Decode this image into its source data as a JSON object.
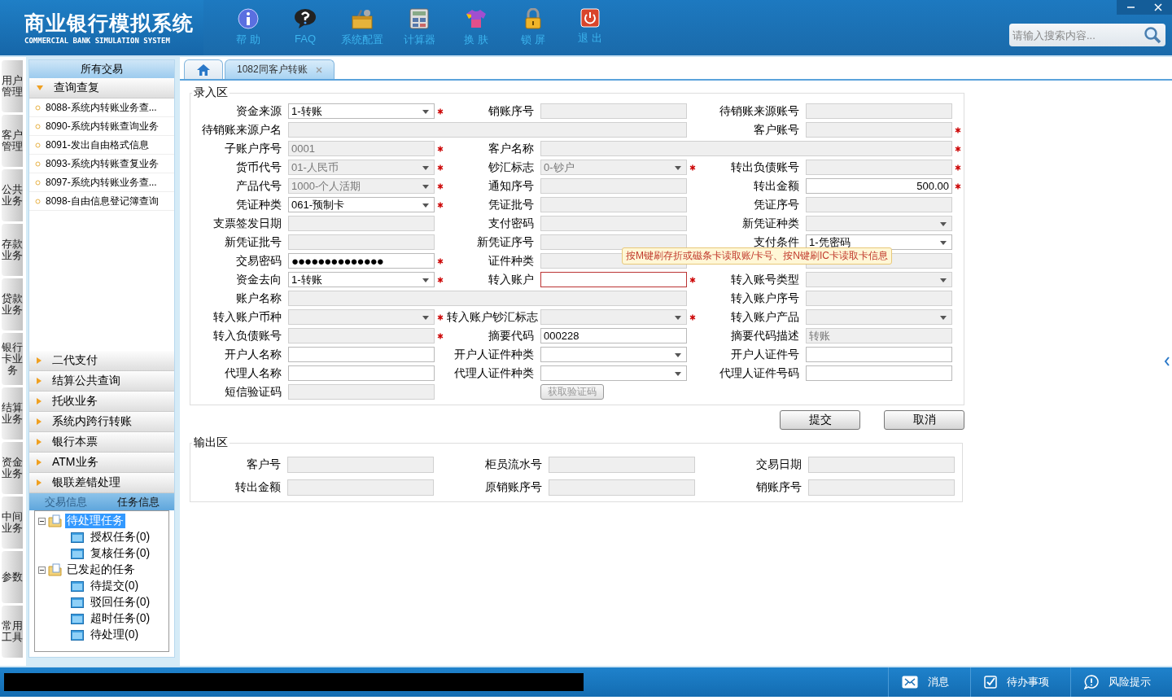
{
  "header": {
    "title": "商业银行模拟系统",
    "subtitle": "COMMERCIAL BANK SIMULATION SYSTEM",
    "nav": [
      {
        "kind": "info",
        "label": "帮 助"
      },
      {
        "kind": "faq",
        "label": "FAQ"
      },
      {
        "kind": "config",
        "label": "系统配置"
      },
      {
        "kind": "calc",
        "label": "计算器"
      },
      {
        "kind": "skin",
        "label": "换 肤"
      },
      {
        "kind": "lock",
        "label": "锁 屏"
      },
      {
        "kind": "exit",
        "label": "退 出"
      }
    ],
    "search": {
      "placeholder": "请输入搜索内容..."
    }
  },
  "tabs": [
    {
      "kind": "home",
      "selected": false
    },
    {
      "kind": "page",
      "label": "1082同客户转账",
      "selected": true
    }
  ],
  "side_tabs": [
    "用户管理",
    "客户管理",
    "公共业务",
    "存款业务",
    "贷款业务",
    "银行卡业务",
    "结算业务",
    "资金业务",
    "中间业务",
    "参数",
    "常用工具"
  ],
  "sidebar": {
    "title": "所有交易",
    "sections": [
      {
        "label": "查询查复",
        "expanded": true,
        "items": [
          "8088-系统内转账业务查...",
          "8090-系统内转账查询业务",
          "8091-发出自由格式信息",
          "8093-系统内转账查复业务",
          "8097-系统内转账业务查...",
          "8098-自由信息登记簿查询"
        ]
      },
      {
        "label": "二代支付",
        "expanded": false
      },
      {
        "label": "结算公共查询",
        "expanded": false
      },
      {
        "label": "托收业务",
        "expanded": false
      },
      {
        "label": "系统内跨行转账",
        "expanded": false
      },
      {
        "label": "银行本票",
        "expanded": false
      },
      {
        "label": "ATM业务",
        "expanded": false
      },
      {
        "label": "银联差错处理",
        "expanded": false
      }
    ],
    "info_tabs": [
      {
        "label": "交易信息",
        "selected": false
      },
      {
        "label": "任务信息",
        "selected": true
      }
    ],
    "tree": [
      {
        "label": "待处理任务",
        "selected": true,
        "expanded": true,
        "children": [
          {
            "label": "授权任务(0)",
            "selected": false
          },
          {
            "label": "复核任务(0)",
            "selected": false
          }
        ]
      },
      {
        "label": "已发起的任务",
        "selected": false,
        "expanded": true,
        "children": [
          {
            "label": "待提交(0)",
            "selected": false
          },
          {
            "label": "驳回任务(0)",
            "selected": false
          },
          {
            "label": "超时任务(0)",
            "selected": false
          },
          {
            "label": "待处理(0)",
            "selected": false
          }
        ]
      }
    ]
  },
  "input_area": {
    "title": "录入区",
    "rows": [
      [
        {
          "label": "资金来源",
          "kind": "select",
          "value": "1-转账",
          "disabled": false,
          "required": true
        },
        {
          "label": "销账序号",
          "kind": "text",
          "disabled": true,
          "required": false
        },
        {
          "label": "待销账来源账号",
          "kind": "text",
          "disabled": true,
          "required": false
        }
      ],
      [
        {
          "label": "待销账来源户名",
          "kind": "text",
          "disabled": true,
          "required": false,
          "wide": true
        },
        {
          "label": "客户账号",
          "kind": "text",
          "disabled": true,
          "required": true
        }
      ],
      [
        {
          "label": "子账户序号",
          "kind": "text",
          "value": "0001",
          "disabled": true,
          "required": true
        },
        {
          "label": "客户名称",
          "kind": "text",
          "disabled": true,
          "required": true,
          "wide": true
        }
      ],
      [
        {
          "label": "货币代号",
          "kind": "select",
          "value": "01-人民币",
          "disabled": true,
          "required": true
        },
        {
          "label": "钞汇标志",
          "kind": "select",
          "value": "0-钞户",
          "disabled": true,
          "required": true
        },
        {
          "label": "转出负债账号",
          "kind": "text",
          "disabled": true,
          "required": true
        }
      ],
      [
        {
          "label": "产品代号",
          "kind": "select",
          "value": "1000-个人活期",
          "disabled": true,
          "required": true
        },
        {
          "label": "通知序号",
          "kind": "text",
          "disabled": true,
          "required": false
        },
        {
          "label": "转出金额",
          "kind": "amount",
          "value": "500.00",
          "disabled": false,
          "required": true
        }
      ],
      [
        {
          "label": "凭证种类",
          "kind": "select",
          "value": "061-预制卡",
          "disabled": false,
          "required": true
        },
        {
          "label": "凭证批号",
          "kind": "text",
          "disabled": true,
          "required": false
        },
        {
          "label": "凭证序号",
          "kind": "text",
          "disabled": true,
          "required": false
        }
      ],
      [
        {
          "label": "支票签发日期",
          "kind": "text",
          "disabled": true,
          "required": false
        },
        {
          "label": "支付密码",
          "kind": "text",
          "disabled": true,
          "required": false
        },
        {
          "label": "新凭证种类",
          "kind": "select",
          "disabled": true,
          "required": false
        }
      ],
      [
        {
          "label": "新凭证批号",
          "kind": "text",
          "disabled": true,
          "required": false
        },
        {
          "label": "新凭证序号",
          "kind": "text",
          "disabled": true,
          "required": false
        },
        {
          "label": "支付条件",
          "kind": "select",
          "value": "1-凭密码",
          "disabled": false,
          "required": false
        }
      ],
      [
        {
          "label": "交易密码",
          "kind": "password",
          "value": "●●●●●●●●●●●●●●",
          "disabled": false,
          "required": true
        },
        {
          "label": "证件种类",
          "kind": "text",
          "disabled": true,
          "required": false
        },
        {
          "kind": "text",
          "disabled": true,
          "required": false
        }
      ],
      [
        {
          "label": "资金去向",
          "kind": "select",
          "value": "1-转账",
          "disabled": false,
          "required": true
        },
        {
          "label": "转入账户",
          "kind": "text",
          "disabled": false,
          "required": true,
          "error": true
        },
        {
          "label": "转入账号类型",
          "kind": "select",
          "disabled": true,
          "required": false
        }
      ],
      [
        {
          "label": "账户名称",
          "kind": "text",
          "disabled": true,
          "required": false,
          "wide": true
        },
        {
          "label": "转入账户序号",
          "kind": "text",
          "disabled": true,
          "required": false
        }
      ],
      [
        {
          "label": "转入账户币种",
          "kind": "select",
          "disabled": true,
          "required": true
        },
        {
          "label": "转入账户钞汇标志",
          "kind": "select",
          "disabled": true,
          "required": true
        },
        {
          "label": "转入账户产品",
          "kind": "select",
          "disabled": true,
          "required": false
        }
      ],
      [
        {
          "label": "转入负债账号",
          "kind": "text",
          "disabled": true,
          "required": true
        },
        {
          "label": "摘要代码",
          "kind": "text",
          "value": "000228",
          "disabled": false,
          "required": false
        },
        {
          "label": "摘要代码描述",
          "kind": "text",
          "value": "转账",
          "disabled": true,
          "required": false
        }
      ],
      [
        {
          "label": "开户人名称",
          "kind": "text",
          "disabled": false,
          "required": false
        },
        {
          "label": "开户人证件种类",
          "kind": "select",
          "disabled": false,
          "required": false
        },
        {
          "label": "开户人证件号",
          "kind": "text",
          "disabled": false,
          "required": false
        }
      ],
      [
        {
          "label": "代理人名称",
          "kind": "text",
          "disabled": false,
          "required": false
        },
        {
          "label": "代理人证件种类",
          "kind": "select",
          "disabled": false,
          "required": false
        },
        {
          "label": "代理人证件号码",
          "kind": "text",
          "disabled": false,
          "required": false
        }
      ],
      [
        {
          "label": "短信验证码",
          "kind": "text",
          "disabled": true,
          "required": false
        },
        {
          "kind": "button",
          "value": "获取验证码",
          "disabled": true,
          "required": false
        }
      ]
    ],
    "tooltip": "按M键刷存折或磁条卡读取账/卡号、按N键刷IC卡读取卡信息"
  },
  "buttons": [
    "提交",
    "取消"
  ],
  "output_area": {
    "title": "输出区",
    "fields": [
      "客户号",
      "柜员流水号",
      "交易日期",
      "转出金额",
      "原销账序号",
      "销账序号"
    ]
  },
  "status_bar": [
    {
      "kind": "message",
      "label": "消息"
    },
    {
      "kind": "todo",
      "label": "待办事项"
    },
    {
      "kind": "risk",
      "label": "风险提示"
    }
  ]
}
